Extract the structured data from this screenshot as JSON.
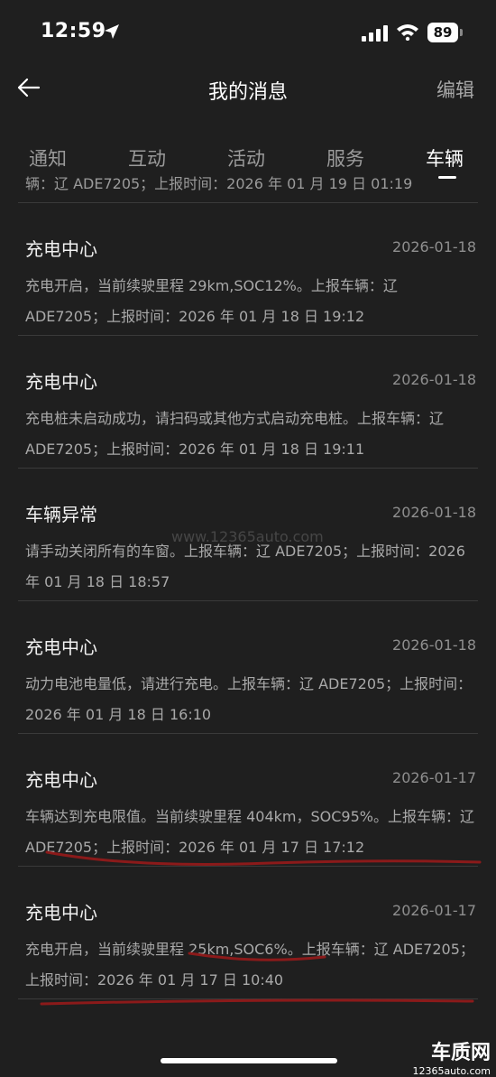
{
  "status_bar": {
    "time": "12:59",
    "battery": "89"
  },
  "nav": {
    "title": "我的消息",
    "edit_label": "编辑"
  },
  "tabs": [
    {
      "label": "通知",
      "active": false
    },
    {
      "label": "互动",
      "active": false
    },
    {
      "label": "活动",
      "active": false
    },
    {
      "label": "服务",
      "active": false
    },
    {
      "label": "车辆",
      "active": true
    }
  ],
  "partial_row": "辆：辽 ADE7205；上报时间：2026 年 01 月 19 日 01:19",
  "messages": [
    {
      "title": "充电中心",
      "date": "2026-01-18",
      "body": "充电开启，当前续驶里程 29km,SOC12%。上报车辆：辽 ADE7205；上报时间：2026 年 01 月 18 日 19:12"
    },
    {
      "title": "充电中心",
      "date": "2026-01-18",
      "body": "充电桩未启动成功，请扫码或其他方式启动充电桩。上报车辆：辽 ADE7205；上报时间：2026 年 01 月 18 日 19:11"
    },
    {
      "title": "车辆异常",
      "date": "2026-01-18",
      "body": "请手动关闭所有的车窗。上报车辆：辽 ADE7205；上报时间：2026 年 01 月 18 日 18:57"
    },
    {
      "title": "充电中心",
      "date": "2026-01-18",
      "body": "动力电池电量低，请进行充电。上报车辆：辽 ADE7205；上报时间：2026 年 01 月 18 日 16:10"
    },
    {
      "title": "充电中心",
      "date": "2026-01-17",
      "body": "车辆达到充电限值。当前续驶里程 404km，SOC95%。上报车辆：辽 ADE7205；上报时间：2026 年 01 月 17 日 17:12"
    },
    {
      "title": "充电中心",
      "date": "2026-01-17",
      "body": "充电开启，当前续驶里程 25km,SOC6%。上报车辆：辽 ADE7205；上报时间：2026 年 01 月 17 日 10:40"
    }
  ],
  "watermark": "www.12365auto.com",
  "brand": {
    "name": "车质网",
    "url": "12365auto.com"
  },
  "colors": {
    "background": "#1f1f1f",
    "annotation": "#8b1a1a"
  }
}
